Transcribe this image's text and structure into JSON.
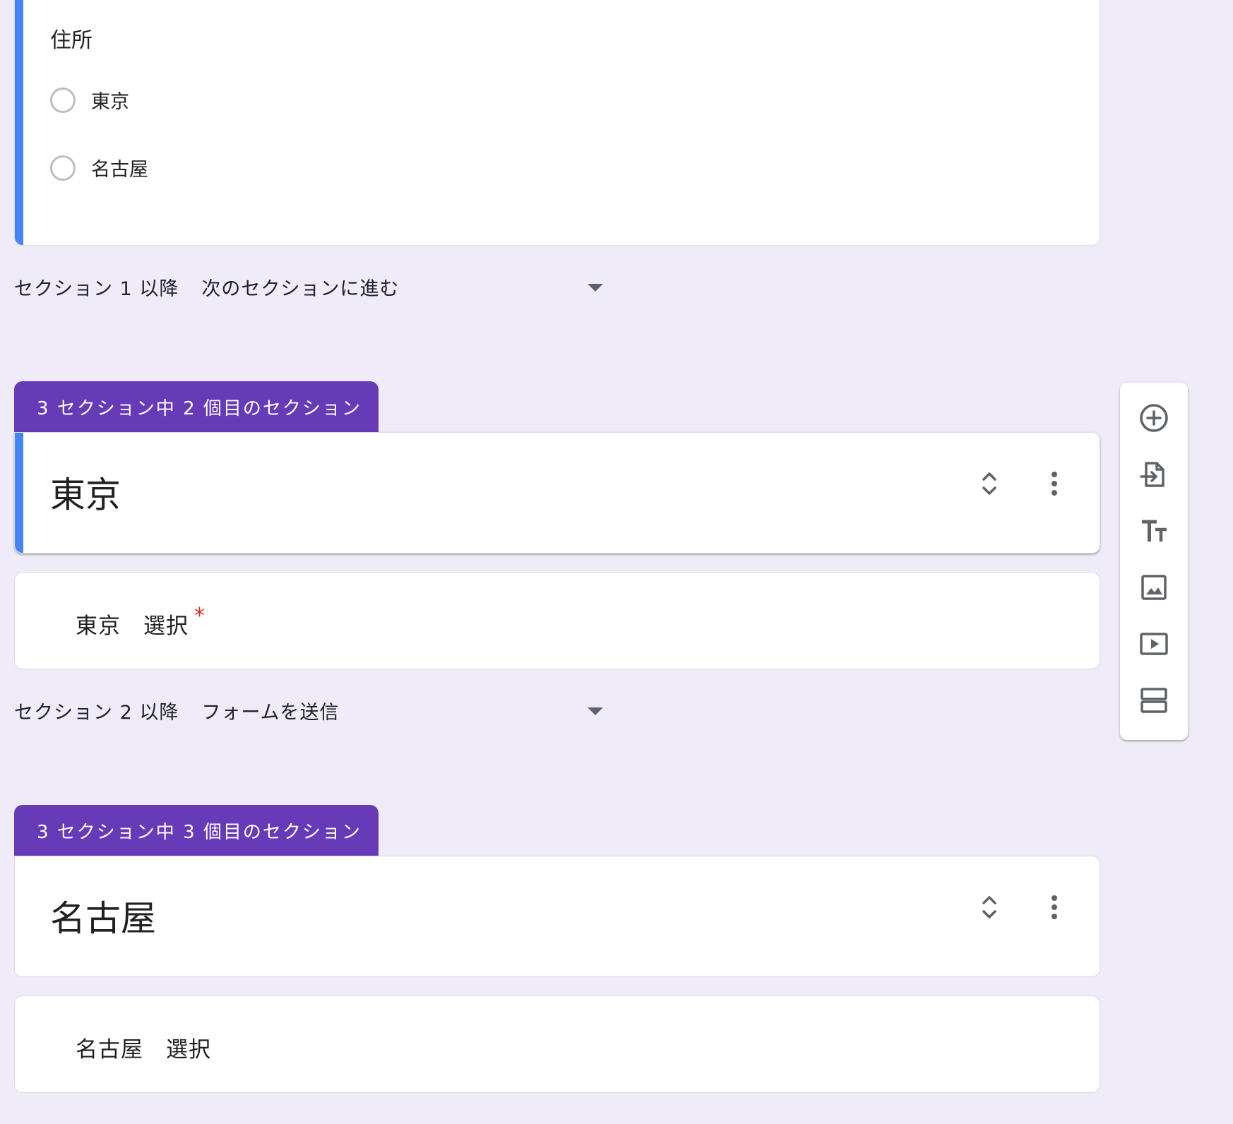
{
  "question_address": {
    "title": "住所",
    "options": [
      "東京",
      "名古屋"
    ]
  },
  "after_section_1": {
    "prefix": "セクション 1 以降",
    "value": "次のセクションに進む"
  },
  "section_2": {
    "tab_label": "3 セクション中 2 個目のセクション",
    "title": "東京",
    "question": {
      "label": "東京　選択",
      "required_mark": "*"
    }
  },
  "after_section_2": {
    "prefix": "セクション 2 以降",
    "value": "フォームを送信"
  },
  "section_3": {
    "tab_label": "3 セクション中 3 個目のセクション",
    "title": "名古屋",
    "question": {
      "label": "名古屋　選択"
    }
  },
  "toolbar": {
    "icons": [
      "add-question-icon",
      "import-questions-icon",
      "add-title-icon",
      "add-image-icon",
      "add-video-icon",
      "add-section-icon"
    ]
  },
  "colors": {
    "background": "#efebf8",
    "section_tab": "#673ab7",
    "active_indicator": "#4285f4",
    "required": "#d93025"
  }
}
